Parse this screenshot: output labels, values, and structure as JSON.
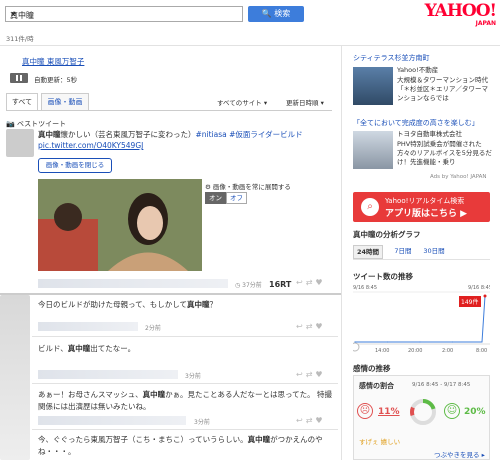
{
  "header": {
    "search_value": "真中瞳",
    "search_button": "検索",
    "logo_text": "YAHOO!",
    "logo_sub": "JAPAN",
    "result_count": "311件/時"
  },
  "left": {
    "query_link": "真中瞳 東風万智子",
    "auto_update": "自動更新：5秒",
    "tabs": [
      {
        "label": "すべて"
      },
      {
        "label": "画像・動画"
      }
    ],
    "sites_label": "すべてのサイト ▾",
    "order_label": "更新日時順 ▾",
    "best_label": "ベストツイート",
    "tweet1": {
      "user": "真中瞳",
      "text1": "懐かしい（芸名東風万智子に変わった）",
      "hashtags": "#nitiasa #仮面ライダービルド",
      "url": "pic.twitter.com/O40KY549GJ"
    },
    "close_media": "画像・動画を閉じる",
    "expand_label": "画像・動画を常に展開する",
    "toggle_on": "オン",
    "toggle_off": "オフ",
    "tweet1_time": "37分前",
    "rt_count": "16RT",
    "tweets": [
      {
        "pre": "今日のビルドが助けた母親って、もしかして",
        "bold": "真中瞳",
        "post": "？",
        "time": "2分前"
      },
      {
        "pre": "ビルド、",
        "bold": "真中瞳",
        "post": "出てたなー。",
        "time": "3分前"
      },
      {
        "pre": "あぁー！お母さんスマッシュ、",
        "bold": "真中瞳",
        "post": "かぁ。見たことある人だなーとは思ってた。 特撮関係には出演歴は無いみたいね。",
        "time": "3分前"
      },
      {
        "pre": "今、ぐぐったら東風万智子（こち・まちこ）っていうらしい。",
        "bold": "真中瞳",
        "post": "がつかえんのやね・・・。",
        "time": ""
      }
    ]
  },
  "right": {
    "ad1_title": "シティテラス杉並方南町",
    "ad1_brand": "Yahoo!不動産",
    "ad1_text": "大規模＆タワーマンション時代「＊杉並区＊エリア／タワーマンションならでは",
    "ad2_title": "「全てにおいて完成度の高さを楽しむ」",
    "ad2_brand": "トヨタ自動車株式会社",
    "ad2_text": "PHV特別試乗会が開催された方々のリアルボイスを5分見るだけ！先進機能・乗り",
    "ads_label": "Ads by Yahoo! JAPAN",
    "banner_line1": "Yahoo!リアルタイム検索",
    "banner_line2": "アプリ版はこちら ▶",
    "graph_title": "真中瞳の分析グラフ",
    "graph_tabs": [
      "24時間",
      "7日間",
      "30日間"
    ],
    "tweet_trend_title": "ツイート数の推移",
    "chart_start": "9/16 8:45",
    "chart_peak": "149件",
    "chart_ticks": [
      "14:00",
      "20:00",
      "2:00",
      "8:00"
    ],
    "sentiment_title": "感情の推移",
    "sentiment_ratio": "感情の割合",
    "sentiment_range": "9/16 8:45 - 9/17 8:45",
    "neg_pct": "11%",
    "pos_pct": "20%",
    "sentiment_words": "すげぇ 嬉しい",
    "view_more": "つぶやきを見る ▸"
  },
  "colors": {
    "accent": "#3d7ddb",
    "link": "#1a4fb8",
    "yahoo_red": "#ff0033",
    "banner": "#e83a3a",
    "chart_line": "#3d7ddb",
    "peak": "#e02020"
  },
  "chart_data": {
    "type": "line",
    "x": [
      "9/16 8:45",
      "14:00",
      "20:00",
      "2:00",
      "8:00"
    ],
    "values": [
      0,
      0,
      0,
      0,
      149
    ],
    "peak_label": "149件"
  }
}
